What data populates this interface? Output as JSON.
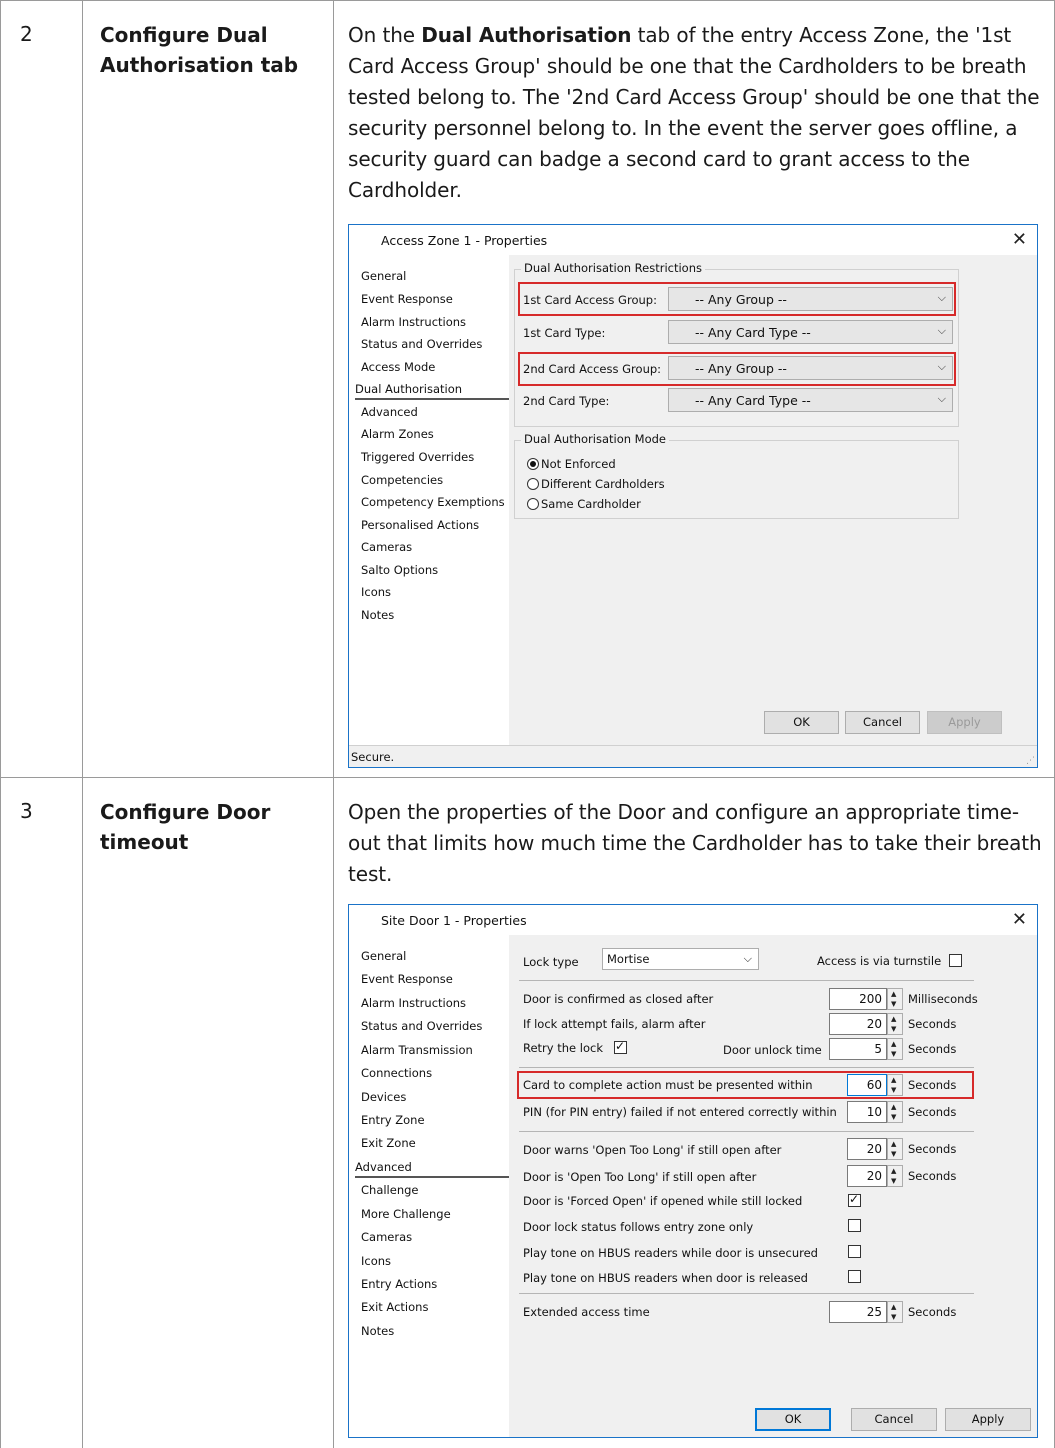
{
  "rows": [
    {
      "number": "2",
      "title": "Configure Dual Authorisation tab",
      "text_before": "On the ",
      "text_bold": "Dual Authorisation",
      "text_after": " tab of the entry Access Zone, the '1st Card Access Group' should be one that the Cardholders to be breath tested belong to. The '2nd Card Access Group' should be one that the security personnel belong to. In the event the server goes offline, a security guard can badge a second card to grant access to the Cardholder."
    },
    {
      "number": "3",
      "title": "Configure Door timeout",
      "text": "Open the properties of the Door and configure an appropriate time-out that limits how much time the Cardholder has to take their breath test."
    }
  ],
  "dialog1": {
    "title": "Access Zone 1 - Properties",
    "nav": [
      "General",
      "Event Response",
      "Alarm Instructions",
      "Status and Overrides",
      "Access Mode",
      "Dual Authorisation",
      "Advanced",
      "Alarm Zones",
      "Triggered Overrides",
      "Competencies",
      "Competency Exemptions",
      "Personalised Actions",
      "Cameras",
      "Salto Options",
      "Icons",
      "Notes"
    ],
    "selected_nav": "Dual Authorisation",
    "restrictions_label": "Dual Authorisation Restrictions",
    "fields": [
      {
        "label": "1st Card Access Group:",
        "value": "-- Any Group --",
        "highlighted": true
      },
      {
        "label": "1st Card Type:",
        "value": "-- Any Card Type --",
        "highlighted": false
      },
      {
        "label": "2nd Card Access Group:",
        "value": "-- Any Group --",
        "highlighted": true
      },
      {
        "label": "2nd Card Type:",
        "value": "-- Any Card Type --",
        "highlighted": false
      }
    ],
    "mode_label": "Dual Authorisation Mode",
    "modes": [
      {
        "label": "Not Enforced",
        "selected": true
      },
      {
        "label": "Different Cardholders",
        "selected": false
      },
      {
        "label": "Same Cardholder",
        "selected": false
      }
    ],
    "buttons": {
      "ok": "OK",
      "cancel": "Cancel",
      "apply": "Apply"
    },
    "status": "Secure."
  },
  "dialog2": {
    "title": "Site Door 1 - Properties",
    "nav": [
      "General",
      "Event Response",
      "Alarm Instructions",
      "Status and Overrides",
      "Alarm Transmission",
      "Connections",
      "Devices",
      "Entry Zone",
      "Exit Zone",
      "Advanced",
      "Challenge",
      "More Challenge",
      "Cameras",
      "Icons",
      "Entry Actions",
      "Exit Actions",
      "Notes"
    ],
    "selected_nav": "Advanced",
    "lock_type_label": "Lock type",
    "lock_type_value": "Mortise",
    "turnstile_label": "Access is via turnstile",
    "turnstile_checked": false,
    "confirmed_closed_label": "Door is confirmed as closed after",
    "confirmed_closed_value": "200",
    "confirmed_closed_unit": "Milliseconds",
    "lock_fail_label": "If lock attempt fails, alarm after",
    "lock_fail_value": "20",
    "lock_fail_unit": "Seconds",
    "retry_label": "Retry the lock",
    "retry_checked": true,
    "unlock_time_label": "Door unlock time",
    "unlock_time_value": "5",
    "unlock_time_unit": "Seconds",
    "card_action_label": "Card to complete action must be presented within",
    "card_action_value": "60",
    "card_action_unit": "Seconds",
    "pin_label": "PIN (for PIN entry) failed if not entered correctly within",
    "pin_value": "10",
    "pin_unit": "Seconds",
    "warn_label": "Door warns 'Open Too Long' if still open after",
    "warn_value": "20",
    "warn_unit": "Seconds",
    "otl_label": "Door is 'Open Too Long' if still open after",
    "otl_value": "20",
    "otl_unit": "Seconds",
    "checks": [
      {
        "label": "Door is 'Forced Open' if opened while still locked",
        "checked": true
      },
      {
        "label": "Door lock status follows entry zone only",
        "checked": false
      },
      {
        "label": "Play tone on HBUS readers while door is unsecured",
        "checked": false
      },
      {
        "label": "Play tone on HBUS readers when door is released",
        "checked": false
      }
    ],
    "extended_label": "Extended access time",
    "extended_value": "25",
    "extended_unit": "Seconds",
    "buttons": {
      "ok": "OK",
      "cancel": "Cancel",
      "apply": "Apply"
    }
  }
}
